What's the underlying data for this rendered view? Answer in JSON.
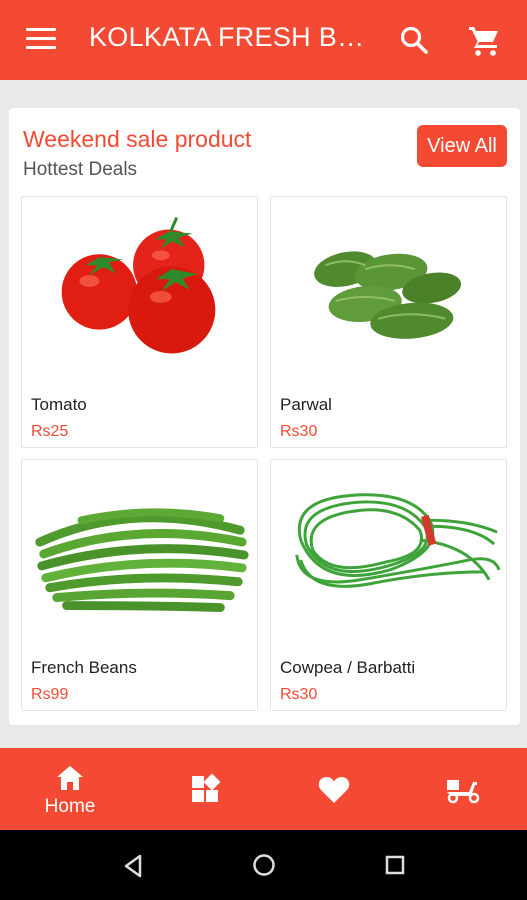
{
  "appbar": {
    "title": "KOLKATA FRESH BAZAR",
    "menu_icon": "hamburger-menu-icon",
    "search_icon": "search-icon",
    "cart_icon": "cart-icon"
  },
  "section": {
    "heading": "Weekend sale product",
    "subheading": "Hottest Deals",
    "view_all_label": "View All"
  },
  "products": [
    {
      "name": "Tomato",
      "price": "Rs25"
    },
    {
      "name": "Parwal",
      "price": "Rs30"
    },
    {
      "name": "French Beans",
      "price": "Rs99"
    },
    {
      "name": "Cowpea / Barbatti",
      "price": "Rs30"
    }
  ],
  "bottom_nav": {
    "home_label": "Home",
    "items": [
      "home-icon",
      "categories-icon",
      "heart-icon",
      "delivery-scooter-icon"
    ]
  },
  "system_nav": [
    "back-icon",
    "home-circle-icon",
    "recents-icon"
  ],
  "colors": {
    "primary": "#f44a33",
    "background": "#e9e9e9"
  }
}
